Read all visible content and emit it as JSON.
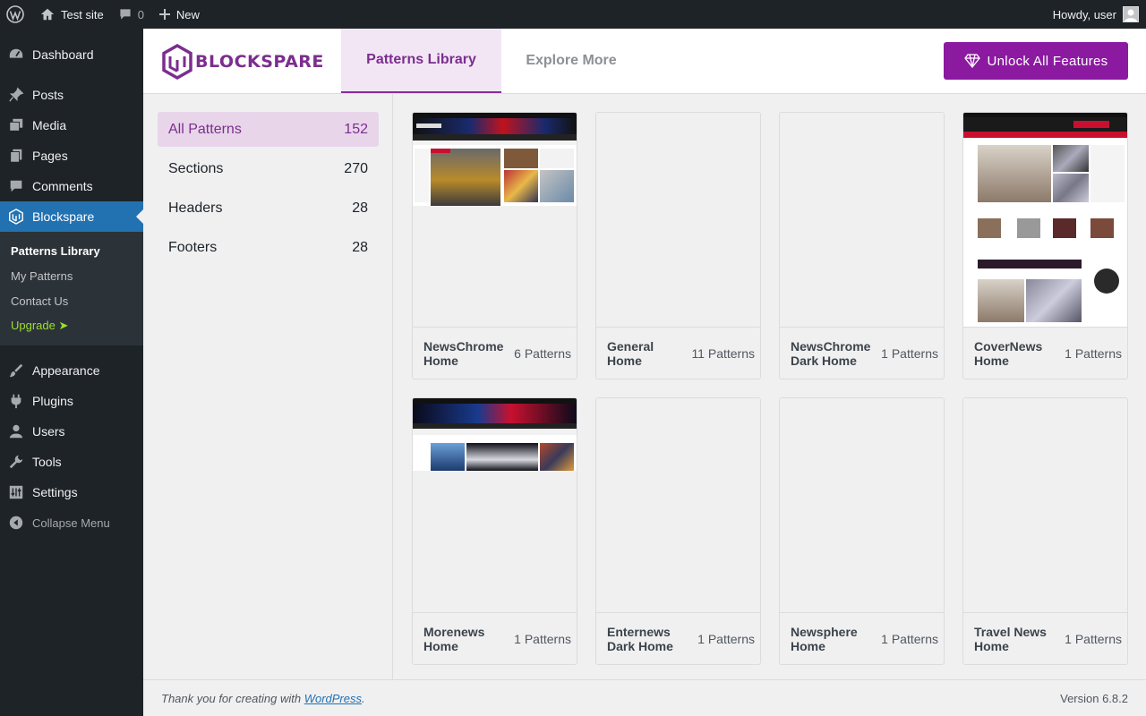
{
  "adminbar": {
    "site_name": "Test site",
    "comments_count": "0",
    "new_label": "New",
    "greeting": "Howdy, user"
  },
  "menu": {
    "items_top": [
      {
        "label": "Dashboard",
        "icon": "dashboard-icon"
      },
      {
        "label": "Posts",
        "icon": "pin-icon"
      },
      {
        "label": "Media",
        "icon": "media-icon"
      },
      {
        "label": "Pages",
        "icon": "pages-icon"
      },
      {
        "label": "Comments",
        "icon": "comments-icon"
      },
      {
        "label": "Blockspare",
        "icon": "blockspare-icon"
      }
    ],
    "submenu": [
      "Patterns Library",
      "My Patterns",
      "Contact Us",
      "Upgrade ➤"
    ],
    "items_bottom": [
      {
        "label": "Appearance",
        "icon": "brush-icon"
      },
      {
        "label": "Plugins",
        "icon": "plugin-icon"
      },
      {
        "label": "Users",
        "icon": "user-icon"
      },
      {
        "label": "Tools",
        "icon": "wrench-icon"
      },
      {
        "label": "Settings",
        "icon": "settings-icon"
      }
    ],
    "collapse_label": "Collapse Menu"
  },
  "header": {
    "logo_text": "BLOCKSPARE",
    "tabs": [
      "Patterns Library",
      "Explore More"
    ],
    "unlock_label": "Unlock All Features"
  },
  "categories": [
    {
      "label": "All Patterns",
      "count": "152"
    },
    {
      "label": "Sections",
      "count": "270"
    },
    {
      "label": "Headers",
      "count": "28"
    },
    {
      "label": "Footers",
      "count": "28"
    }
  ],
  "cards": [
    {
      "name": "NewsChrome Home",
      "count": "6 Patterns"
    },
    {
      "name": "General Home",
      "count": "11 Patterns"
    },
    {
      "name": "NewsChrome Dark Home",
      "count": "1 Patterns"
    },
    {
      "name": "CoverNews Home",
      "count": "1 Patterns"
    },
    {
      "name": "Morenews Home",
      "count": "1 Patterns"
    },
    {
      "name": "Enternews Dark Home",
      "count": "1 Patterns"
    },
    {
      "name": "Newsphere Home",
      "count": "1 Patterns"
    },
    {
      "name": "Travel News Home",
      "count": "1 Patterns"
    }
  ],
  "footer": {
    "thanks_prefix": "Thank you for creating with ",
    "thanks_link": "WordPress",
    "thanks_suffix": ".",
    "version": "Version 6.8.2"
  },
  "colors": {
    "accent": "#8b1aa0",
    "admin_blue": "#2271b1",
    "admin_dark": "#1d2327",
    "upgrade_green": "#9bdf31"
  }
}
